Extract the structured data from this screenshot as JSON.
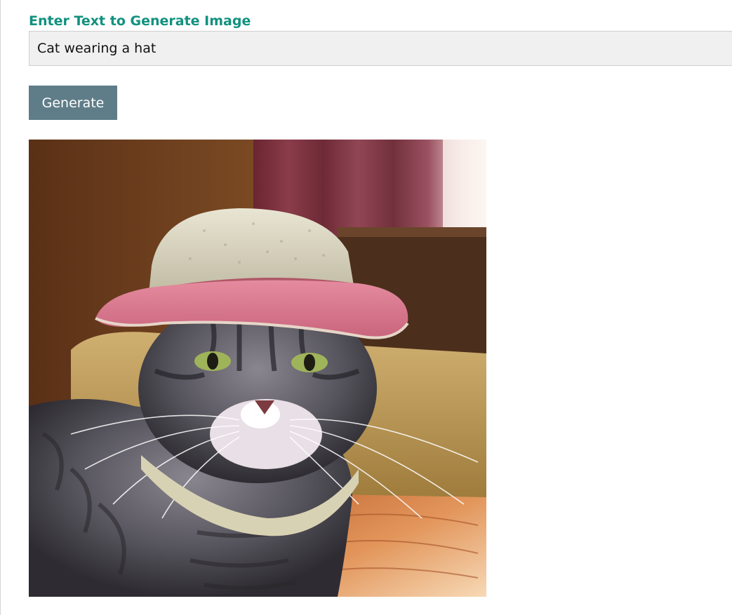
{
  "form": {
    "label": "Enter Text to Generate Image",
    "input_value": "Cat wearing a hat",
    "button_label": "Generate"
  },
  "result": {
    "image_alt": "Generated image of a tabby cat wearing a cream hat with a pink brim"
  },
  "colors": {
    "label": "#12917f",
    "button_bg": "#5f7d88",
    "input_bg": "#f0f0f0"
  }
}
